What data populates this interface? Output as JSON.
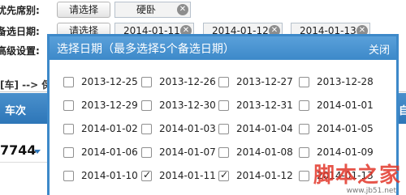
{
  "form": {
    "row1_label": "优先席别:",
    "row1_button": "请选择",
    "row1_tag": "硬卧",
    "row2_label": "备选日期:",
    "row2_button": "请选择",
    "row2_tags": [
      "2014-01-11",
      "2014-01-12",
      "2014-01-13"
    ],
    "row3_label": "高级设置:",
    "bar_text": "[车] --> 保定",
    "col_train": "车次",
    "col_right": "自",
    "train_number": "7744"
  },
  "popup": {
    "title": "选择日期（最多选择5个备选日期）",
    "close_label": "关闭",
    "dates": [
      {
        "label": "2013-12-25",
        "checked": false
      },
      {
        "label": "2013-12-26",
        "checked": false
      },
      {
        "label": "2013-12-27",
        "checked": false
      },
      {
        "label": "2013-12-28",
        "checked": false
      },
      {
        "label": "2013-12-29",
        "checked": false
      },
      {
        "label": "2013-12-30",
        "checked": false
      },
      {
        "label": "2013-12-31",
        "checked": false
      },
      {
        "label": "2014-01-01",
        "checked": false
      },
      {
        "label": "2014-01-02",
        "checked": false
      },
      {
        "label": "2014-01-03",
        "checked": false
      },
      {
        "label": "2014-01-04",
        "checked": false
      },
      {
        "label": "2014-01-05",
        "checked": false
      },
      {
        "label": "2014-01-06",
        "checked": false
      },
      {
        "label": "2014-01-07",
        "checked": false
      },
      {
        "label": "2014-01-08",
        "checked": false
      },
      {
        "label": "2014-01-09",
        "checked": false
      },
      {
        "label": "2014-01-10",
        "checked": false
      },
      {
        "label": "2014-01-11",
        "checked": true
      },
      {
        "label": "2014-01-12",
        "checked": true
      },
      {
        "label": "2014-01-13",
        "checked": false
      }
    ]
  },
  "watermark": {
    "text": "脚本之家",
    "url": "www.jb51.net"
  },
  "colors": {
    "accent": "#3d89c9",
    "table_header": "#2d76b8"
  },
  "icons": {
    "remove": "x-circle-icon",
    "dropdown": "caret-down-icon",
    "checked": "check-icon"
  }
}
